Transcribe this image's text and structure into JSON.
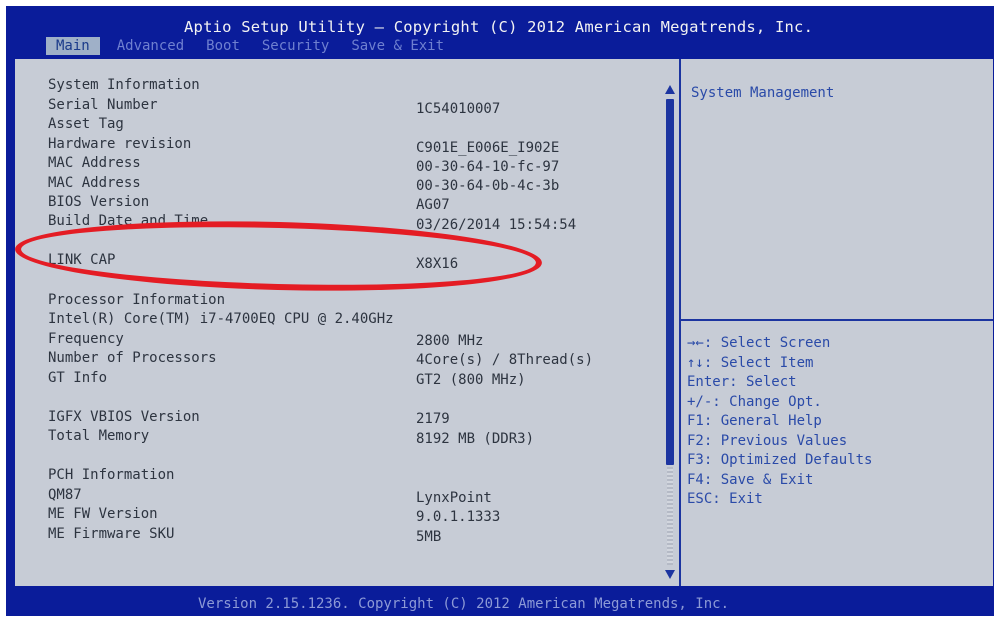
{
  "title": "Aptio Setup Utility – Copyright (C) 2012 American Megatrends, Inc.",
  "tabs": [
    "Main",
    "Advanced",
    "Boot",
    "Security",
    "Save & Exit"
  ],
  "rows": [
    {
      "label": "System Information",
      "value": ""
    },
    {
      "label": "Serial Number",
      "value": "1C54010007"
    },
    {
      "label": "Asset Tag",
      "value": ""
    },
    {
      "label": "Hardware revision",
      "value": "C901E_E006E_I902E"
    },
    {
      "label": "MAC Address",
      "value": "00-30-64-10-fc-97"
    },
    {
      "label": "MAC Address",
      "value": "00-30-64-0b-4c-3b"
    },
    {
      "label": "BIOS Version",
      "value": "AG07"
    },
    {
      "label": "Build Date and Time",
      "value": "03/26/2014 15:54:54"
    },
    {
      "label": "LINK CAP",
      "value": "X8X16"
    },
    {
      "label": "Processor Information",
      "value": ""
    },
    {
      "label": "Intel(R) Core(TM) i7-4700EQ CPU @ 2.40GHz",
      "value": ""
    },
    {
      "label": "Frequency",
      "value": "2800 MHz"
    },
    {
      "label": "Number of Processors",
      "value": "4Core(s) / 8Thread(s)"
    },
    {
      "label": "GT Info",
      "value": "GT2 (800 MHz)"
    },
    {
      "label": "IGFX VBIOS Version",
      "value": "2179"
    },
    {
      "label": "Total Memory",
      "value": "8192 MB (DDR3)"
    },
    {
      "label": "PCH Information",
      "value": ""
    },
    {
      "label": "QM87",
      "value": "LynxPoint"
    },
    {
      "label": "ME FW Version",
      "value": "9.0.1.1333"
    },
    {
      "label": "ME Firmware SKU",
      "value": "5MB"
    }
  ],
  "help": {
    "top": "System Management",
    "keys": [
      "→←: Select Screen",
      "↑↓: Select Item",
      "Enter: Select",
      "+/-: Change Opt.",
      "F1: General Help",
      "F2: Previous Values",
      "F3: Optimized Defaults",
      "F4: Save & Exit",
      "ESC: Exit"
    ]
  },
  "footer": "Version 2.15.1236. Copyright (C) 2012 American Megatrends, Inc.",
  "colors": {
    "background_blue": "#0a1c9a",
    "panel_gray": "#c7ccd6",
    "highlight_ring": "#e41c24",
    "help_text": "#2a4aa8"
  }
}
